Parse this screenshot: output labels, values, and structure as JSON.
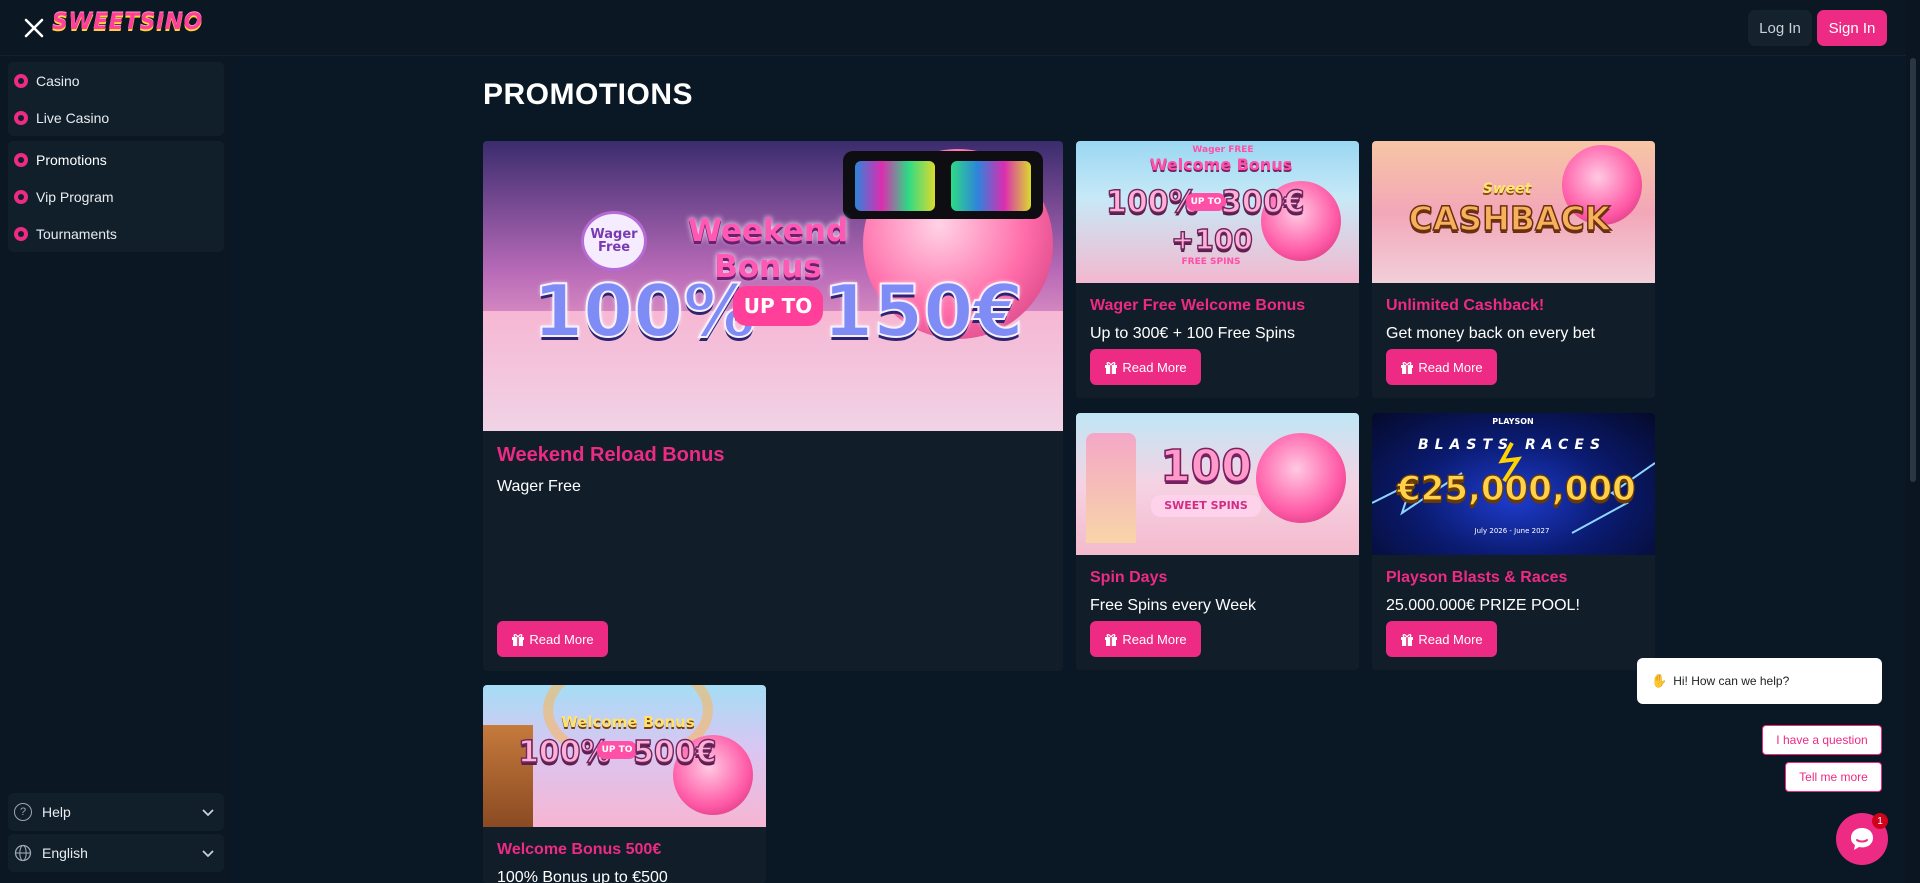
{
  "header": {
    "logo_text": "SWEETSINO",
    "login_label": "Log In",
    "signin_label": "Sign In"
  },
  "sidebar": {
    "group1": [
      {
        "label": "Casino",
        "icon": "casino-chip-icon"
      },
      {
        "label": "Live Casino",
        "icon": "live-casino-icon"
      }
    ],
    "group2": [
      {
        "label": "Promotions",
        "icon": "gift-icon"
      },
      {
        "label": "Vip Program",
        "icon": "crown-icon"
      },
      {
        "label": "Tournaments",
        "icon": "trophy-icon"
      }
    ],
    "help_label": "Help",
    "language_label": "English"
  },
  "main": {
    "title": "PROMOTIONS",
    "read_more_label": "Read More",
    "cards": [
      {
        "title": "Weekend Reload Bonus",
        "subtitle": "Wager Free",
        "banner": {
          "tag": "Wager Free",
          "headline": "Weekend Bonus",
          "amount": "100%",
          "up_to": "UP TO",
          "max": "150€"
        }
      },
      {
        "title": "Wager Free Welcome Bonus",
        "subtitle": "Up to 300€ + 100 Free Spins",
        "banner": {
          "tag": "Wager FREE",
          "headline": "Welcome Bonus",
          "amount": "100%",
          "up_to": "UP TO",
          "max": "300€",
          "extra": "+100",
          "extra_sub": "FREE SPINS"
        }
      },
      {
        "title": "Unlimited Cashback!",
        "subtitle": "Get money back on every bet",
        "banner": {
          "tag": "Sweet",
          "headline": "CASHBACK"
        }
      },
      {
        "title": "Spin Days",
        "subtitle": "Free Spins every Week",
        "banner": {
          "amount": "100",
          "headline": "SWEET SPINS"
        }
      },
      {
        "title": "Playson Blasts & Races",
        "subtitle": "25.000.000€ PRIZE POOL!",
        "banner": {
          "brand": "PLAYSON",
          "headline": "BLASTS RACES",
          "amount": "€25,000,000",
          "dates": "July 2026 - June 2027"
        }
      },
      {
        "title": "Welcome Bonus 500€",
        "subtitle": "100% Bonus up to €500",
        "banner": {
          "headline": "Welcome Bonus",
          "amount": "100%",
          "up_to": "UP TO",
          "max": "500€"
        }
      }
    ]
  },
  "chat": {
    "greeting": "Hi! How can we help?",
    "wave_icon": "waving-hand-icon",
    "option1": "I have a question",
    "option2": "Tell me more",
    "badge_count": "1"
  },
  "colors": {
    "accent": "#ed2a84",
    "background": "#0a1826",
    "panel": "#111e2a"
  }
}
